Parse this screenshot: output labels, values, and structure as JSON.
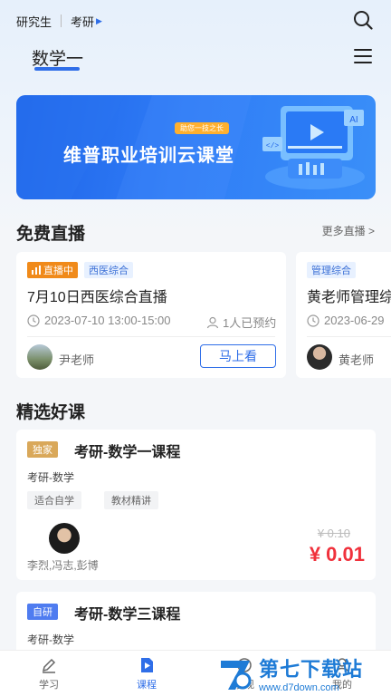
{
  "header": {
    "level": "研究生",
    "category": "考研",
    "subject": "数学一",
    "search_icon": "search-icon",
    "menu_icon": "menu-icon"
  },
  "banner": {
    "title": "维普职业培训云课堂",
    "tag": "助您一技之长"
  },
  "live": {
    "section_title": "免费直播",
    "more_label": "更多直播 >",
    "cards": [
      {
        "status": "直播中",
        "category": "西医综合",
        "title": "7月10日西医综合直播",
        "time": "2023-07-10 13:00-15:00",
        "reservations": "1人已预约",
        "teacher": "尹老师",
        "button": "马上看"
      },
      {
        "category": "管理综合",
        "title": "黄老师管理综",
        "time": "2023-06-29",
        "teacher": "黄老师"
      }
    ]
  },
  "courses": {
    "section_title": "精选好课",
    "items": [
      {
        "badge": "独家",
        "badge_color": "#d9a85a",
        "title": "考研-数学一课程",
        "subtitle": "考研-数学",
        "tags": [
          "适合自学",
          "教材精讲"
        ],
        "teachers": "李烈,冯志,彭博",
        "price_old": "¥ 0.10",
        "price_new": "¥ 0.01"
      },
      {
        "badge": "自研",
        "badge_color": "#4f7cf0",
        "title": "考研-数学三课程",
        "subtitle": "考研-数学"
      }
    ]
  },
  "tabbar": {
    "items": [
      {
        "label": "学习",
        "icon": "pencil-icon"
      },
      {
        "label": "课程",
        "icon": "play-icon",
        "active": true
      },
      {
        "label": "发现",
        "icon": "discover-icon"
      },
      {
        "label": "我的",
        "icon": "user-icon"
      }
    ]
  },
  "watermark": {
    "brand": "第七下载站",
    "url": "www.d7down.com"
  },
  "colors": {
    "accent": "#2f6ee8",
    "price": "#f0313c",
    "live_badge": "#f08a1a"
  }
}
